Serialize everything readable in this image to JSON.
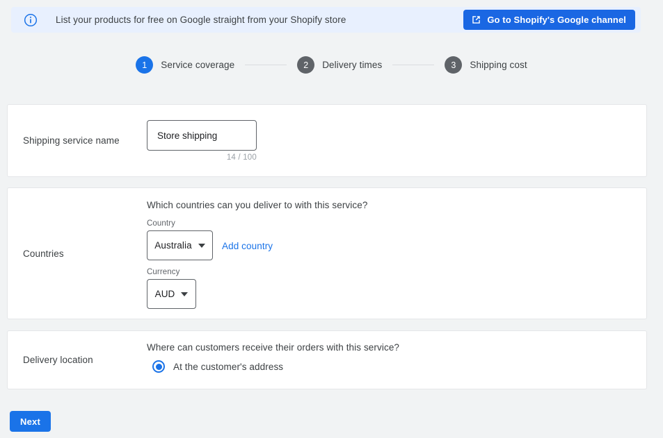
{
  "banner": {
    "icon": "info-circle-icon",
    "text": "List your products for free on Google straight from your Shopify store",
    "button_label": "Go to Shopify's Google channel",
    "button_icon": "open-in-new-icon",
    "background_color": "#e8f0fe",
    "button_color": "#1a67e3"
  },
  "stepper": {
    "active_color": "#1a73e8",
    "inactive_color": "#5f6368",
    "steps": [
      {
        "number": "1",
        "label": "Service coverage",
        "state": "active"
      },
      {
        "number": "2",
        "label": "Delivery times",
        "state": "inactive"
      },
      {
        "number": "3",
        "label": "Shipping cost",
        "state": "inactive"
      }
    ]
  },
  "sections": {
    "service_name": {
      "label": "Shipping service name",
      "value": "Store shipping",
      "placeholder": "Shipping service name",
      "counter": "14 / 100"
    },
    "countries": {
      "label": "Countries",
      "question": "Which countries can you deliver to with this service?",
      "country_field_label": "Country",
      "country_value": "Australia",
      "add_country_link": "Add country",
      "currency_field_label": "Currency",
      "currency_value": "AUD"
    },
    "delivery_location": {
      "label": "Delivery location",
      "question": "Where can customers receive their orders with this service?",
      "option_label": "At the customer's address",
      "option_selected": true
    }
  },
  "footer": {
    "next_label": "Next",
    "next_color": "#1a73e8"
  }
}
